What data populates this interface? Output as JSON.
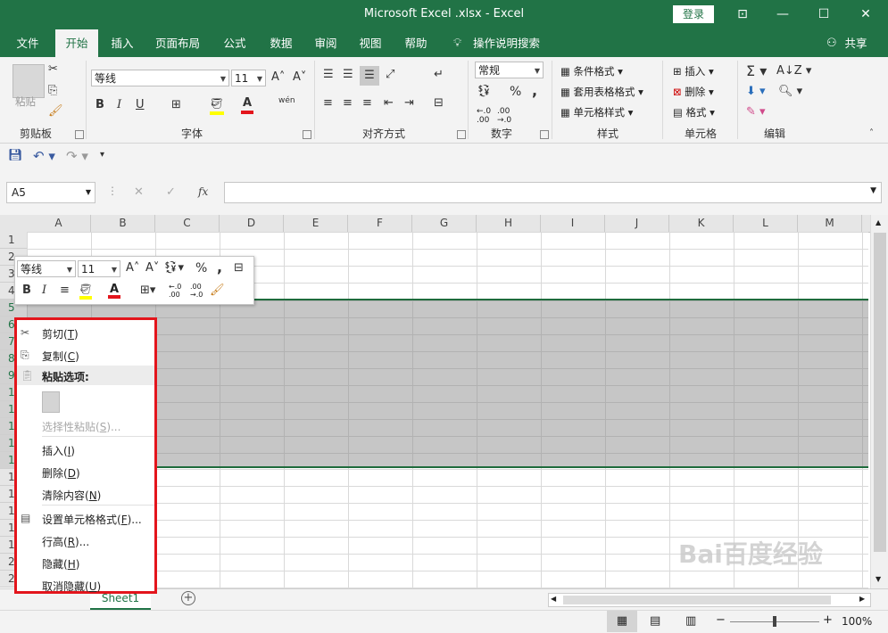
{
  "window": {
    "title": "Microsoft Excel .xlsx  -  Excel",
    "login": "登录",
    "controls": {
      "ribbon_opts": "⊡",
      "minimize": "—",
      "maximize": "☐",
      "close": "✕"
    }
  },
  "menu": {
    "tabs": [
      "文件",
      "开始",
      "插入",
      "页面布局",
      "公式",
      "数据",
      "审阅",
      "视图",
      "帮助"
    ],
    "tell_me": "操作说明搜索",
    "share": "共享"
  },
  "ribbon": {
    "clipboard": {
      "label": "剪贴板",
      "paste": "粘贴"
    },
    "font": {
      "label": "字体",
      "name": "等线",
      "size": "11",
      "bold": "B",
      "italic": "I",
      "underline": "U",
      "wen": "wén"
    },
    "align": {
      "label": "对齐方式"
    },
    "number": {
      "label": "数字",
      "format": "常规",
      "percent": "%",
      "comma": ","
    },
    "styles": {
      "label": "样式",
      "conditional": "条件格式",
      "table": "套用表格格式",
      "cell": "单元格样式"
    },
    "cells": {
      "label": "单元格",
      "insert": "插入",
      "delete": "删除",
      "format": "格式"
    },
    "editing": {
      "label": "编辑"
    }
  },
  "namebox": {
    "value": "A5"
  },
  "formula_icons": {
    "cancel": "✕",
    "enter": "✓",
    "fx": "fx"
  },
  "columns": [
    "A",
    "B",
    "C",
    "D",
    "E",
    "F",
    "G",
    "H",
    "I",
    "J",
    "K",
    "L",
    "M"
  ],
  "rows": [
    "1",
    "2",
    "3",
    "4",
    "5",
    "6",
    "7",
    "8",
    "9",
    "10",
    "11",
    "12",
    "13",
    "14",
    "15",
    "16",
    "17",
    "18",
    "19",
    "20",
    "21",
    "22"
  ],
  "mini_toolbar": {
    "font": "等线",
    "size": "11",
    "bold": "B",
    "italic": "I",
    "percent": "%",
    "comma": ","
  },
  "context_menu": {
    "cut": {
      "label": "剪切(",
      "key": "T",
      "end": ")"
    },
    "copy": {
      "label": "复制(",
      "key": "C",
      "end": ")"
    },
    "paste_options": "粘贴选项:",
    "paste_special": {
      "label": "选择性粘贴(",
      "key": "S",
      "end": ")..."
    },
    "insert": {
      "label": "插入(",
      "key": "I",
      "end": ")"
    },
    "delete": {
      "label": "删除(",
      "key": "D",
      "end": ")"
    },
    "clear": {
      "label": "清除内容(",
      "key": "N",
      "end": ")"
    },
    "format_cells": {
      "label": "设置单元格格式(",
      "key": "F",
      "end": ")..."
    },
    "row_height": {
      "label": "行高(",
      "key": "R",
      "end": ")..."
    },
    "hide": {
      "label": "隐藏(",
      "key": "H",
      "end": ")"
    },
    "unhide": {
      "label": "取消隐藏(",
      "key": "U",
      "end": ")"
    }
  },
  "sheet": {
    "tab": "Sheet1",
    "add": "+"
  },
  "status": {
    "zoom": "100%",
    "minus": "−",
    "plus": "+"
  },
  "watermark": "Bai百度经验",
  "colors": {
    "accent": "#217346",
    "highlight": "#e3151c"
  }
}
